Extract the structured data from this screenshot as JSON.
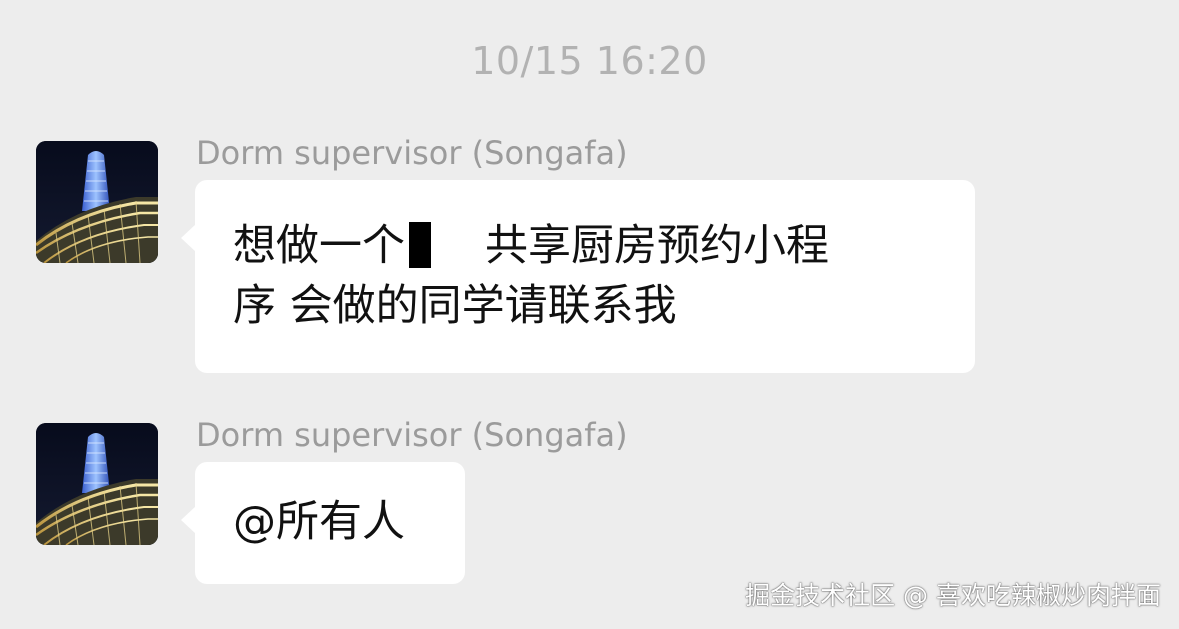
{
  "chat": {
    "timestamp": "10/15 16:20",
    "messages": [
      {
        "sender": "Dorm supervisor (Songafa)",
        "text_line1_before": "想做一个",
        "text_line1_after": "共享厨房预约小程",
        "text_line2": "序  会做的同学请联系我"
      },
      {
        "sender": "Dorm supervisor (Songafa)",
        "text": "@所有人"
      }
    ]
  },
  "watermark": {
    "text": "掘金技术社区 @ 喜欢吃辣椒炒肉拌面"
  },
  "colors": {
    "background": "#ededed",
    "bubble": "#ffffff",
    "timestamp": "#b2b2b2",
    "sender": "#9b9b9b"
  },
  "icons": {
    "avatar": "tower-night-photo"
  }
}
